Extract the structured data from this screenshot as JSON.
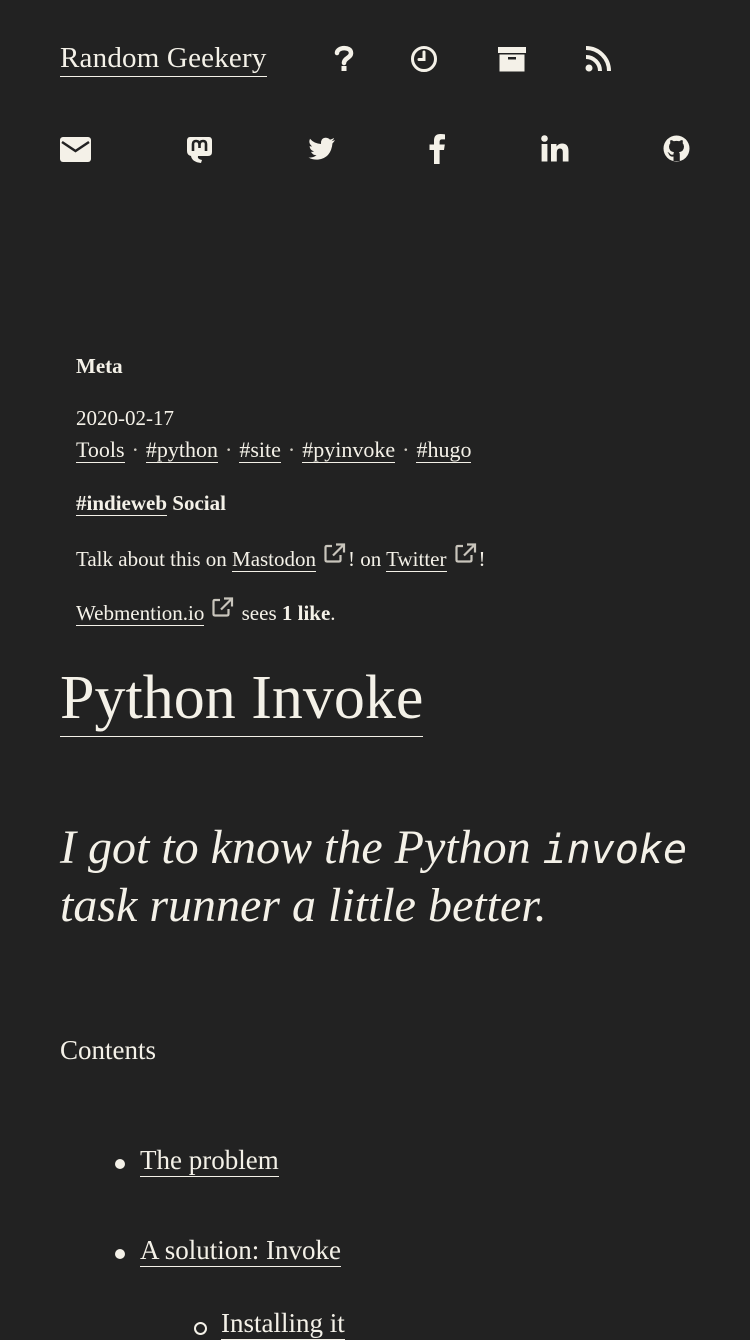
{
  "header": {
    "site_title": "Random Geekery",
    "nav_icons": [
      "question-icon",
      "clock-icon",
      "archive-icon",
      "rss-icon"
    ],
    "social_icons": [
      "envelope-icon",
      "mastodon-icon",
      "twitter-icon",
      "facebook-icon",
      "linkedin-icon",
      "github-icon"
    ]
  },
  "meta": {
    "heading": "Meta",
    "date": "2020-02-17",
    "category": "Tools",
    "tags": [
      "#python",
      "#site",
      "#pyinvoke",
      "#hugo"
    ],
    "separator": "·",
    "indieweb_tag": "#indieweb",
    "social_label": "Social",
    "talk_prefix": "Talk about this on",
    "mastodon_link": "Mastodon",
    "talk_mid": "! on",
    "twitter_link": "Twitter",
    "talk_end": "!",
    "webmention_link": "Webmention.io",
    "sees": "sees",
    "likes": "1 like",
    "period": "."
  },
  "post": {
    "title": "Python Invoke",
    "lead_1": "I got to know the Python",
    "lead_code": "invoke",
    "lead_2": "task runner a little better.",
    "contents_label": "Contents",
    "toc": [
      "The problem",
      "A solution: Invoke"
    ],
    "toc_sub": [
      "Installing it"
    ]
  },
  "colors": {
    "background": "#222222",
    "text": "#f4f1e8",
    "external_icon": "#c9c5bc"
  }
}
